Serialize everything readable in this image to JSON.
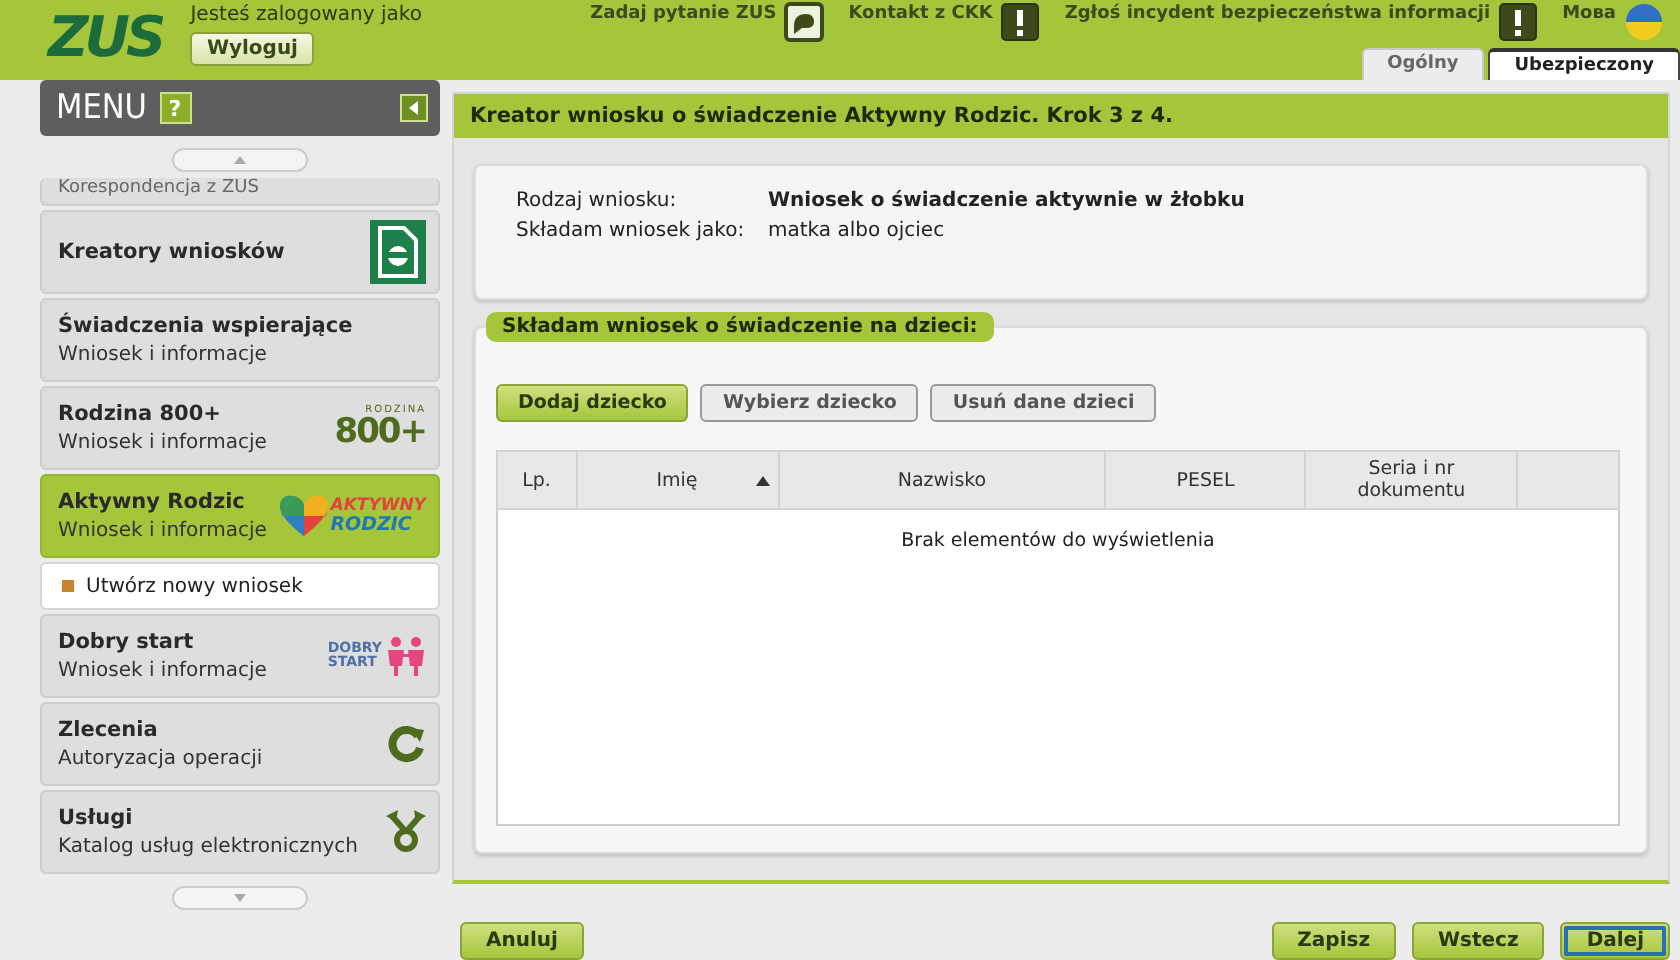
{
  "header": {
    "logo": "ZUS",
    "login_label": "Jesteś zalogowany jako",
    "logout": "Wyloguj",
    "links": [
      {
        "label": "Zadaj pytanie ZUS",
        "kind": "question"
      },
      {
        "label": "Kontakt z CKK",
        "kind": "alert"
      },
      {
        "label": "Zgłoś incydent bezpieczeństwa informacji",
        "kind": "alert"
      },
      {
        "label": "Мова",
        "kind": "language"
      }
    ],
    "tabs": [
      {
        "label": "Ogólny",
        "selected": false
      },
      {
        "label": "Ubezpieczony",
        "selected": true
      }
    ]
  },
  "sidebar": {
    "title": "MENU",
    "help": "?",
    "items": [
      {
        "title": "Korespondencja z ZUS",
        "kind": "partial",
        "selected": false
      },
      {
        "title": "Kreatory wniosków",
        "kind": "document",
        "selected": false
      },
      {
        "title": "Świadczenia wspierające",
        "subtitle": "Wniosek i informacje",
        "kind": "plain",
        "selected": false
      },
      {
        "title": "Rodzina 800+",
        "subtitle": "Wniosek i informacje",
        "kind": "rodzina",
        "logo": [
          "RODZINA",
          "800+"
        ],
        "selected": false
      },
      {
        "title": "Aktywny Rodzic",
        "subtitle": "Wniosek i informacje",
        "kind": "aktywny",
        "logo": [
          "AKTYWNY",
          "RODZIC"
        ],
        "selected": true,
        "children": [
          {
            "label": "Utwórz nowy wniosek"
          }
        ]
      },
      {
        "title": "Dobry start",
        "subtitle": "Wniosek i informacje",
        "kind": "dobry",
        "logo": [
          "DOBRY",
          "START"
        ],
        "selected": false
      },
      {
        "title": "Zlecenia",
        "subtitle": "Autoryzacja operacji",
        "kind": "refresh",
        "selected": false
      },
      {
        "title": "Usługi",
        "subtitle": "Katalog usług elektronicznych",
        "kind": "services",
        "selected": false
      }
    ]
  },
  "main": {
    "title": "Kreator wniosku o świadczenie Aktywny Rodzic. Krok 3 z 4.",
    "info": [
      {
        "label": "Rodzaj wniosku:",
        "value": "Wniosek o świadczenie aktywnie w żłobku",
        "bold": true
      },
      {
        "label": "Składam wniosek jako:",
        "value": "matka albo ojciec",
        "bold": false
      }
    ],
    "section": {
      "title": "Składam wniosek o świadczenie na dzieci:",
      "buttons": [
        {
          "label": "Dodaj dziecko",
          "disabled": false
        },
        {
          "label": "Wybierz dziecko",
          "disabled": true
        },
        {
          "label": "Usuń dane dzieci",
          "disabled": true
        }
      ],
      "table": {
        "columns": [
          {
            "label": "Lp.",
            "sorted": false
          },
          {
            "label": "Imię",
            "sorted": true
          },
          {
            "label": "Nazwisko",
            "sorted": false
          },
          {
            "label": "PESEL",
            "sorted": false
          },
          {
            "label": "Seria i nr dokumentu",
            "sorted": false
          }
        ],
        "empty": "Brak elementów do wyświetlenia"
      }
    }
  },
  "footer": {
    "left": [
      {
        "label": "Anuluj",
        "focused": false
      }
    ],
    "right": [
      {
        "label": "Zapisz",
        "focused": false
      },
      {
        "label": "Wstecz",
        "focused": false
      },
      {
        "label": "Dalej",
        "focused": true
      }
    ]
  }
}
